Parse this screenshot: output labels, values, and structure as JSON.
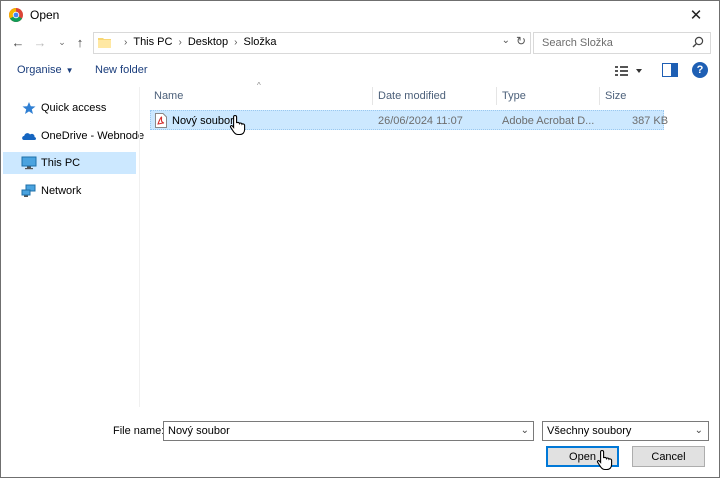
{
  "window": {
    "title": "Open",
    "close_glyph": "✕"
  },
  "nav": {
    "back_glyph": "←",
    "forward_glyph": "→",
    "recent_glyph": "⌄",
    "up_glyph": "↑",
    "breadcrumbs": [
      "This PC",
      "Desktop",
      "Složka"
    ],
    "search_placeholder": "Search Složka"
  },
  "toolbar": {
    "organise_label": "Organise",
    "new_folder_label": "New folder",
    "help_glyph": "?"
  },
  "sidebar": {
    "items": [
      {
        "label": "Quick access",
        "icon": "star-icon"
      },
      {
        "label": "OneDrive - Webnode",
        "icon": "cloud-icon"
      },
      {
        "label": "This PC",
        "icon": "computer-icon",
        "selected": true
      },
      {
        "label": "Network",
        "icon": "network-icon"
      }
    ]
  },
  "file_list": {
    "columns": [
      "Name",
      "Date modified",
      "Type",
      "Size"
    ],
    "rows": [
      {
        "name": "Nový soubor",
        "date": "26/06/2024 11:07",
        "type": "Adobe Acrobat D...",
        "size": "387 KB",
        "icon": "pdf-icon"
      }
    ]
  },
  "footer": {
    "file_name_label": "File name:",
    "file_name_value": "Nový soubor",
    "file_type_value": "Všechny soubory",
    "open_label": "Open",
    "cancel_label": "Cancel"
  },
  "colors": {
    "accent": "#0078d7",
    "selection": "#cce8ff",
    "link": "#1a3d7c"
  }
}
